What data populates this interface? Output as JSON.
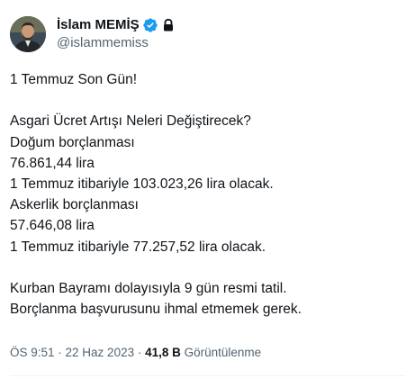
{
  "author": {
    "display_name": "İslam MEMİŞ",
    "handle": "@islammemiss",
    "verified": true,
    "protected": true,
    "verified_color": "#1d9bf0"
  },
  "tweet": {
    "lines": [
      "1 Temmuz Son Gün!",
      "",
      "Asgari Ücret Artışı Neleri Değiştirecek?",
      "Doğum borçlanması",
      "76.861,44 lira",
      "1 Temmuz itibariyle 103.023,26 lira olacak.",
      "Askerlik borçlanması",
      "57.646,08 lira",
      "1 Temmuz itibariyle 77.257,52 lira olacak.",
      "",
      "Kurban Bayramı dolayısıyla 9 gün resmi tatil.",
      "Borçlanma başvurusunu ihmal etmemek gerek."
    ]
  },
  "meta": {
    "time": "ÖS 9:51",
    "separator": " · ",
    "date": "22 Haz 2023",
    "views_count": "41,8 B",
    "views_label": "Görüntülenme"
  },
  "colors": {
    "text": "#0f1419",
    "secondary": "#536471",
    "divider": "#eff3f4"
  }
}
